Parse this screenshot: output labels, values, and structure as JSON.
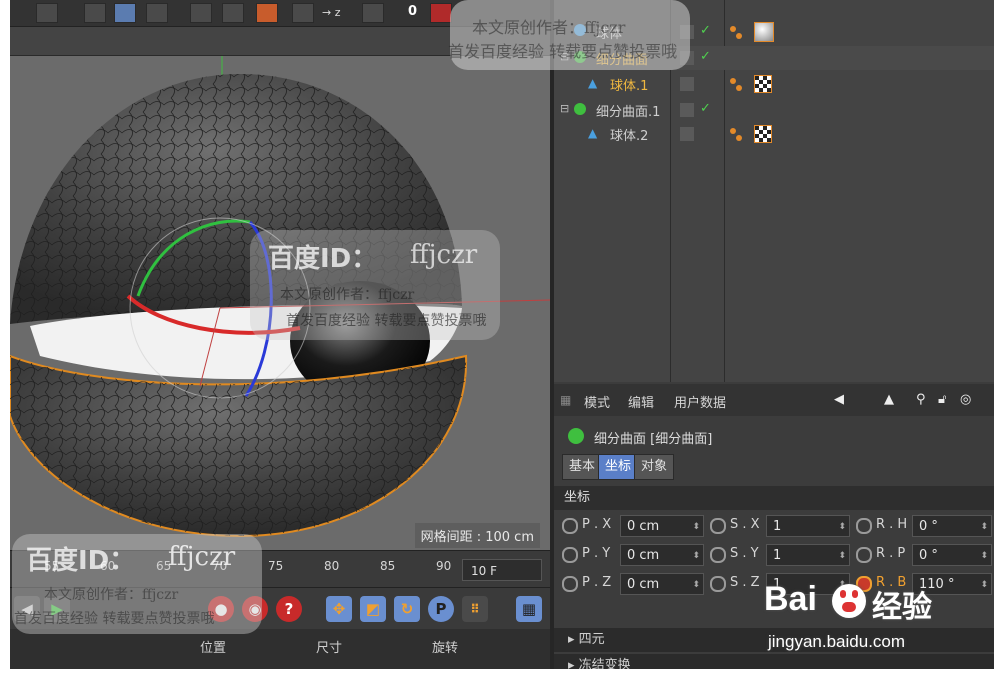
{
  "viewport": {
    "grid_spacing_label": "网格间距 : 100 cm"
  },
  "toolbar": {
    "value_zero": "0",
    "axis_label": "→ z"
  },
  "timeline": {
    "ticks": [
      "55",
      "60",
      "65",
      "70",
      "75",
      "80",
      "85",
      "90"
    ],
    "current_frame": "10 F"
  },
  "attr_tabs_bottom": {
    "position": "位置",
    "size": "尺寸",
    "rotation": "旋转"
  },
  "objects": {
    "rows": [
      {
        "name": "球体"
      },
      {
        "name": "细分曲面"
      },
      {
        "name": "球体.1"
      },
      {
        "name": "细分曲面.1"
      },
      {
        "name": "球体.2"
      }
    ]
  },
  "attributes": {
    "menu": {
      "mode": "模式",
      "edit": "编辑",
      "user_data": "用户数据"
    },
    "object_title": "细分曲面 [细分曲面]",
    "tabs": {
      "basic": "基本",
      "coord": "坐标",
      "object": "对象"
    },
    "section": "坐标",
    "params": {
      "px_label": "P . X",
      "px_value": "0 cm",
      "py_label": "P . Y",
      "py_value": "0 cm",
      "pz_label": "P . Z",
      "pz_value": "0 cm",
      "sx_label": "S . X",
      "sx_value": "1",
      "sy_label": "S . Y",
      "sy_value": "1",
      "sz_label": "S . Z",
      "sz_value": "1",
      "rh_label": "R . H",
      "rh_value": "0 °",
      "rp_label": "R . P",
      "rp_value": "0 °",
      "rb_label": "R . B",
      "rb_value": "110 °"
    },
    "collapsed": {
      "quaternion": "▸ 四元",
      "freeze": "▸ 冻结变换"
    }
  },
  "watermarks": {
    "author_line": "本文原创作者：ffjczr",
    "repost_line": "首发百度经验 转载要点赞投票哦",
    "baidu_id_prefix": "百度ID：",
    "baidu_id_name": "ffjczr",
    "brand_text": "Bai",
    "brand_jingyan": "经验",
    "brand_url": "jingyan.baidu.com"
  },
  "colors": {
    "accent": "#f0a030",
    "green": "#4fd04f",
    "bg": "#3c3c3c"
  }
}
